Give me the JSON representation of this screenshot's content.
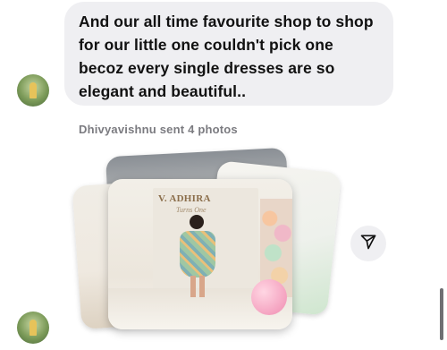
{
  "message": {
    "text": "And our all time favourite shop to shop for our little one couldn't pick one becoz every single dresses are so elegant and beautiful.."
  },
  "photos": {
    "sent_label": "Dhivyavishnu sent 4 photos",
    "banner_title": "V. ADHIRA",
    "banner_subtitle": "Turns One"
  },
  "icons": {
    "share": "send-arrow-icon",
    "avatar": "user-avatar"
  },
  "colors": {
    "bubble_bg": "#efeff2",
    "text": "#111111",
    "muted_text": "#7b7b80"
  }
}
